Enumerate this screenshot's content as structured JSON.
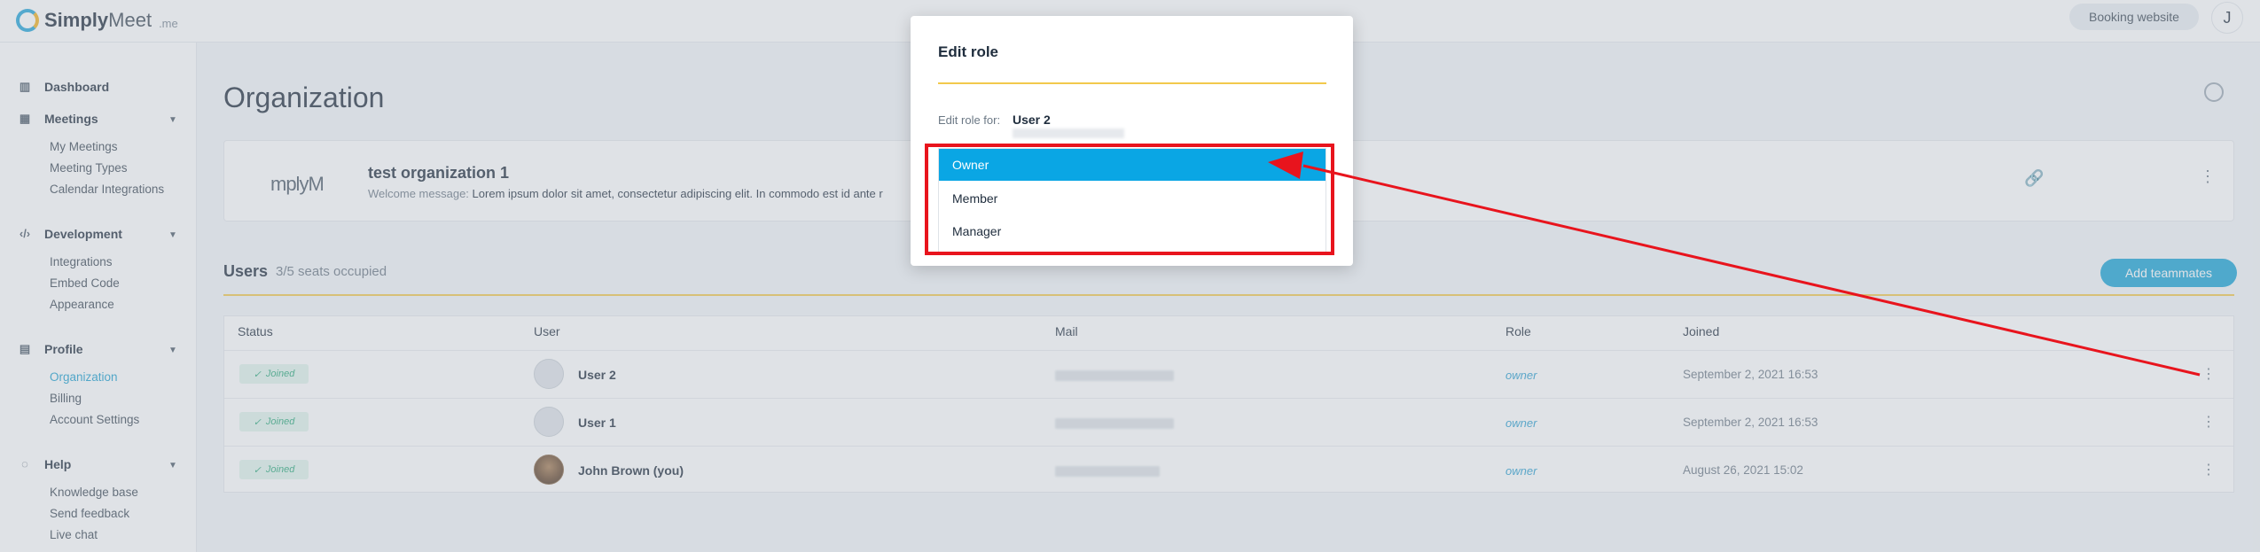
{
  "app": {
    "logo_bold": "Simply",
    "logo_light": "Meet",
    "logo_suffix": ".me",
    "booking_button": "Booking website",
    "user_initial": "J"
  },
  "sidebar": {
    "dashboard": "Dashboard",
    "meetings": {
      "label": "Meetings",
      "items": [
        "My Meetings",
        "Meeting Types",
        "Calendar Integrations"
      ]
    },
    "development": {
      "label": "Development",
      "items": [
        "Integrations",
        "Embed Code",
        "Appearance"
      ]
    },
    "profile": {
      "label": "Profile",
      "items": [
        "Organization",
        "Billing",
        "Account Settings"
      ]
    },
    "help": {
      "label": "Help",
      "items": [
        "Knowledge base",
        "Send feedback",
        "Live chat"
      ]
    }
  },
  "main": {
    "title": "Organization",
    "org": {
      "logo_text": "mplyM",
      "name": "test organization 1",
      "welcome_label": "Welcome message:",
      "welcome_text": "Lorem ipsum dolor sit amet, consectetur adipiscing elit. In commodo est id ante r"
    },
    "users": {
      "title": "Users",
      "seats": "3/5 seats occupied",
      "add_button": "Add teammates",
      "columns": [
        "Status",
        "User",
        "Mail",
        "Role",
        "Joined"
      ],
      "rows": [
        {
          "status": "Joined",
          "name": "User 2",
          "role": "owner",
          "joined": "September 2, 2021 16:53"
        },
        {
          "status": "Joined",
          "name": "User 1",
          "role": "owner",
          "joined": "September 2, 2021 16:53"
        },
        {
          "status": "Joined",
          "name": "John Brown (you)",
          "role": "owner",
          "joined": "August 26, 2021 15:02"
        }
      ]
    }
  },
  "modal": {
    "title": "Edit role",
    "role_for_label": "Edit role for:",
    "role_for_user": "User 2",
    "options": [
      "Owner",
      "Member",
      "Manager"
    ],
    "selected": "Owner"
  },
  "colors": {
    "accent": "#0aa6e4",
    "annotation": "#e8141d",
    "divider": "#f2c94c",
    "joined_badge": "#2aa87a"
  }
}
